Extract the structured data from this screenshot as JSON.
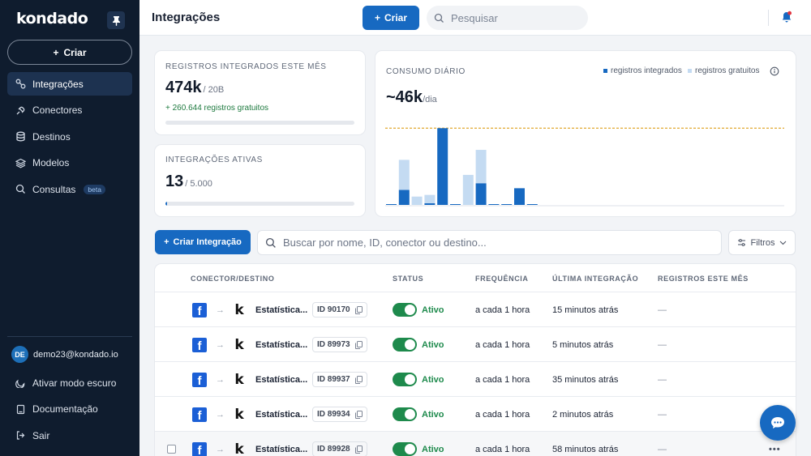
{
  "sidebar": {
    "logo": "kondado",
    "create_label": "Criar",
    "nav": [
      {
        "label": "Integrações",
        "icon": "integrations-icon",
        "active": true
      },
      {
        "label": "Conectores",
        "icon": "connectors-icon"
      },
      {
        "label": "Destinos",
        "icon": "database-icon"
      },
      {
        "label": "Modelos",
        "icon": "layers-icon"
      },
      {
        "label": "Consultas",
        "icon": "search-icon",
        "badge": "beta"
      }
    ],
    "user_initials": "DE",
    "user_email": "demo23@kondado.io",
    "bottom": [
      {
        "label": "Ativar modo escuro",
        "icon": "moon-icon"
      },
      {
        "label": "Documentação",
        "icon": "book-icon"
      },
      {
        "label": "Sair",
        "icon": "logout-icon"
      }
    ]
  },
  "header": {
    "title": "Integrações",
    "create_label": "Criar",
    "search_placeholder": "Pesquisar"
  },
  "cards": {
    "records": {
      "label": "REGISTROS INTEGRADOS ESTE MÊS",
      "value": "474k",
      "limit": "/ 20B",
      "note": "+ 260.644 registros gratuitos",
      "progress": 0.0
    },
    "active": {
      "label": "INTEGRAÇÕES ATIVAS",
      "value": "13",
      "limit": "/ 5.000",
      "progress": 0.003
    },
    "daily": {
      "label": "CONSUMO DIÁRIO",
      "value": "~46k",
      "unit": "/dia",
      "legend_integrated": "registros integrados",
      "legend_free": "registros gratuitos"
    }
  },
  "chart_data": {
    "type": "bar",
    "x": [
      1,
      2,
      3,
      4,
      5,
      6,
      7,
      8,
      9,
      10,
      11,
      12
    ],
    "series": [
      {
        "name": "registros integrados",
        "values": [
          0,
          9,
          0,
          1,
          46,
          0,
          0,
          13,
          0,
          0,
          10,
          0
        ]
      },
      {
        "name": "registros gratuitos",
        "values": [
          0,
          18,
          5,
          5,
          0,
          0,
          18,
          20,
          0,
          0,
          0,
          0
        ]
      }
    ],
    "stacked": true,
    "reference_line": 46,
    "ylim": [
      0,
      50
    ],
    "colors": {
      "integrated": "#1769c1",
      "free": "#c4dbf2",
      "reference": "#e0a82e"
    }
  },
  "toolbar": {
    "create_integration_label": "Criar Integração",
    "search_placeholder": "Buscar por nome, ID, conector ou destino...",
    "filters_label": "Filtros"
  },
  "table": {
    "headers": {
      "connector": "CONECTOR/DESTINO",
      "status": "STATUS",
      "frequency": "FREQUÊNCIA",
      "last": "ÚLTIMA INTEGRAÇÃO",
      "records": "REGISTROS ESTE MÊS"
    },
    "rows": [
      {
        "name": "Estatística...",
        "id": "ID 90170",
        "status": "Ativo",
        "frequency": "a cada 1 hora",
        "last": "15 minutos atrás",
        "records": "—"
      },
      {
        "name": "Estatística...",
        "id": "ID 89973",
        "status": "Ativo",
        "frequency": "a cada 1 hora",
        "last": "5 minutos atrás",
        "records": "—"
      },
      {
        "name": "Estatística...",
        "id": "ID 89937",
        "status": "Ativo",
        "frequency": "a cada 1 hora",
        "last": "35 minutos atrás",
        "records": "—"
      },
      {
        "name": "Estatística...",
        "id": "ID 89934",
        "status": "Ativo",
        "frequency": "a cada 1 hora",
        "last": "2 minutos atrás",
        "records": "—"
      },
      {
        "name": "Estatística...",
        "id": "ID 89928",
        "status": "Ativo",
        "frequency": "a cada 1 hora",
        "last": "58 minutos atrás",
        "records": "—"
      }
    ]
  }
}
